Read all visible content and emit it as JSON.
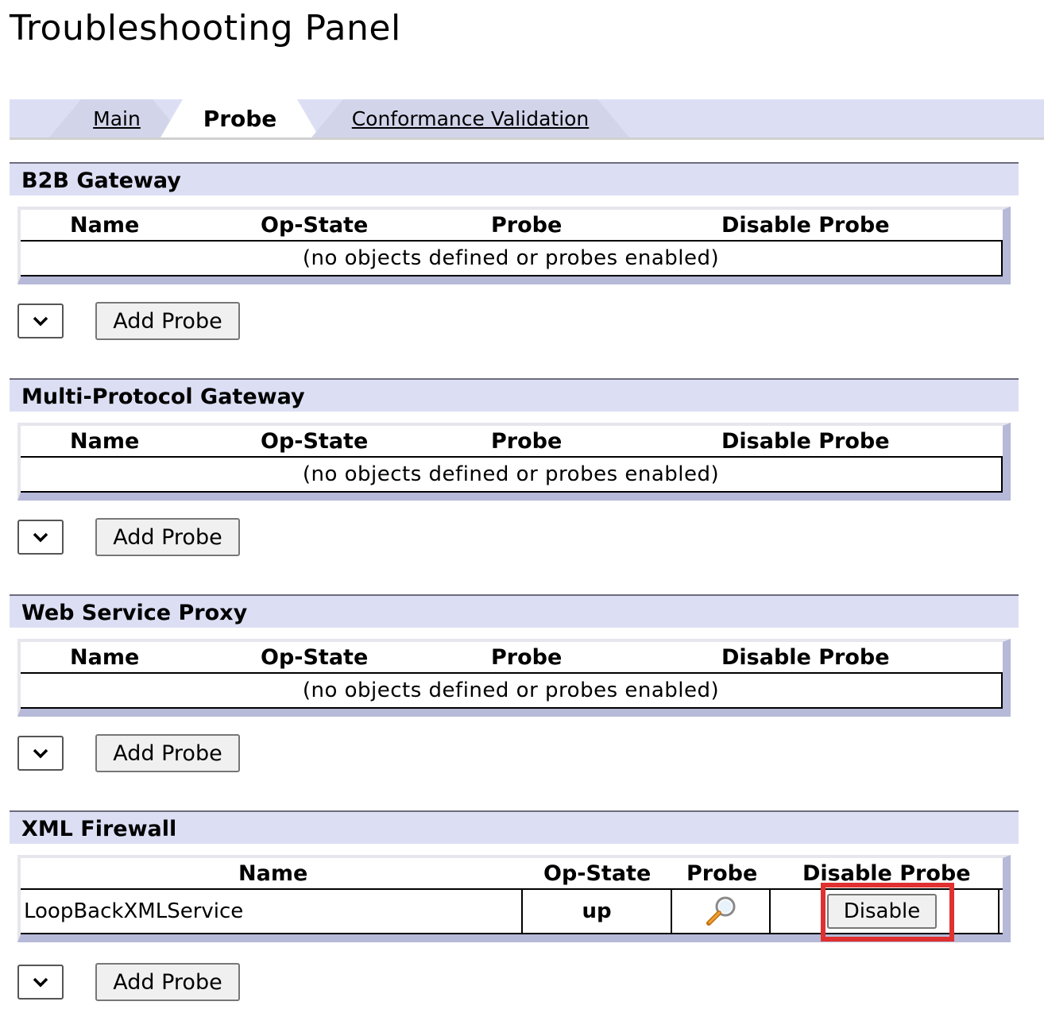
{
  "page": {
    "title": "Troubleshooting Panel"
  },
  "tabs": [
    {
      "label": "Main",
      "active": false
    },
    {
      "label": "Probe",
      "active": true
    },
    {
      "label": "Conformance Validation",
      "active": false
    }
  ],
  "columns": {
    "name": "Name",
    "op_state": "Op-State",
    "probe": "Probe",
    "disable_probe": "Disable Probe"
  },
  "empty_message": "(no objects defined or probes enabled)",
  "add_probe_label": "Add Probe",
  "sections": [
    {
      "title": "B2B Gateway"
    },
    {
      "title": "Multi-Protocol Gateway"
    },
    {
      "title": "Web Service Proxy"
    },
    {
      "title": "XML Firewall",
      "rows": [
        {
          "name": "LoopBackXMLService",
          "op_state": "up",
          "probe_icon": "magnifier-icon",
          "disable_label": "Disable"
        }
      ]
    }
  ],
  "colors": {
    "header_bg": "#dcdff4",
    "table_shadow": "#b6b9d8",
    "highlight": "#e03030"
  }
}
